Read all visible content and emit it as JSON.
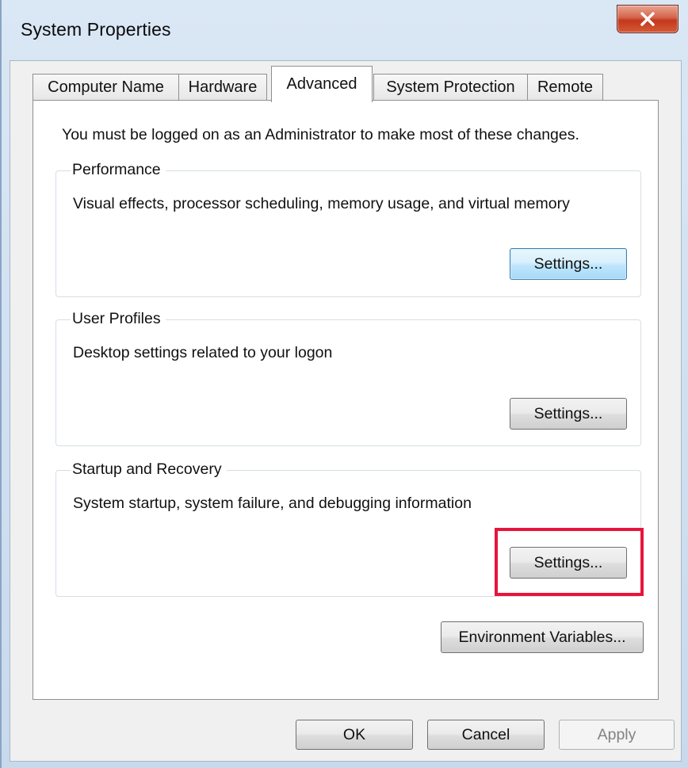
{
  "window": {
    "title": "System Properties",
    "close_icon": "close-icon"
  },
  "tabs": [
    {
      "label": "Computer Name",
      "active": false
    },
    {
      "label": "Hardware",
      "active": false
    },
    {
      "label": "Advanced",
      "active": true
    },
    {
      "label": "System Protection",
      "active": false
    },
    {
      "label": "Remote",
      "active": false
    }
  ],
  "advanced": {
    "admin_notice": "You must be logged on as an Administrator to make most of these changes.",
    "performance": {
      "label": "Performance",
      "description": "Visual effects, processor scheduling, memory usage, and virtual memory",
      "button": "Settings..."
    },
    "user_profiles": {
      "label": "User Profiles",
      "description": "Desktop settings related to your logon",
      "button": "Settings..."
    },
    "startup_recovery": {
      "label": "Startup and Recovery",
      "description": "System startup, system failure, and debugging information",
      "button": "Settings..."
    },
    "environment_variables": "Environment Variables..."
  },
  "footer": {
    "ok": "OK",
    "cancel": "Cancel",
    "apply": "Apply"
  },
  "colors": {
    "highlight": "#e8143c",
    "focus_border": "#3c7fb1"
  }
}
